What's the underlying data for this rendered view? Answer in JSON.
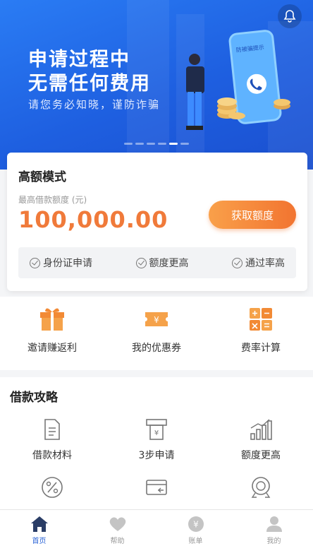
{
  "banner": {
    "title_line1": "申请过程中",
    "title_line2": "无需任何费用",
    "subtitle": "请您务必知晓，谨防诈骗",
    "phone_label": "防被骗提示",
    "slide_count": 6,
    "active_slide": 5
  },
  "quota_card": {
    "mode_title": "高额模式",
    "limit_label": "最高借款额度 (元)",
    "amount": "100,000.00",
    "get_button_label": "获取额度",
    "features": [
      "身份证申请",
      "额度更高",
      "通过率高"
    ]
  },
  "quick_actions": [
    {
      "label": "邀请赚返利",
      "icon": "gift-icon"
    },
    {
      "label": "我的优惠券",
      "icon": "coupon-icon"
    },
    {
      "label": "费率计算",
      "icon": "calculator-icon"
    }
  ],
  "guide": {
    "title": "借款攻略",
    "items": [
      {
        "label": "借款材料",
        "icon": "document-icon"
      },
      {
        "label": "3步申请",
        "icon": "atm-icon"
      },
      {
        "label": "额度更高",
        "icon": "bar-chart-icon"
      },
      {
        "label": "",
        "icon": "percent-icon"
      },
      {
        "label": "",
        "icon": "card-icon"
      },
      {
        "label": "",
        "icon": "badge-icon"
      }
    ]
  },
  "tabbar": [
    {
      "label": "首页",
      "icon": "home-icon",
      "active": true
    },
    {
      "label": "帮助",
      "icon": "heart-icon",
      "active": false
    },
    {
      "label": "账单",
      "icon": "yen-icon",
      "active": false
    },
    {
      "label": "我的",
      "icon": "user-icon",
      "active": false
    }
  ],
  "colors": {
    "accent_orange": "#f27430",
    "banner_blue": "#1e5fe0",
    "tab_active": "#2a63d6"
  }
}
